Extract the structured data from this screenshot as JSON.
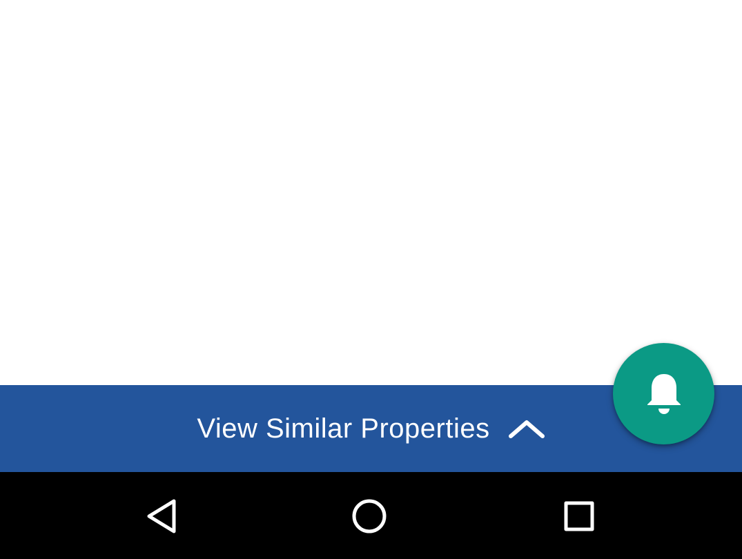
{
  "similar_bar": {
    "label": "View Similar Properties",
    "chevron_icon": "chevron-up-icon",
    "background": "#23559c",
    "text_color": "#ffffff"
  },
  "fab": {
    "icon": "bell-icon",
    "background": "#0b9a85"
  },
  "system_nav": {
    "back_icon": "back-triangle-icon",
    "home_icon": "home-circle-icon",
    "recents_icon": "recents-square-icon",
    "background": "#000000"
  }
}
